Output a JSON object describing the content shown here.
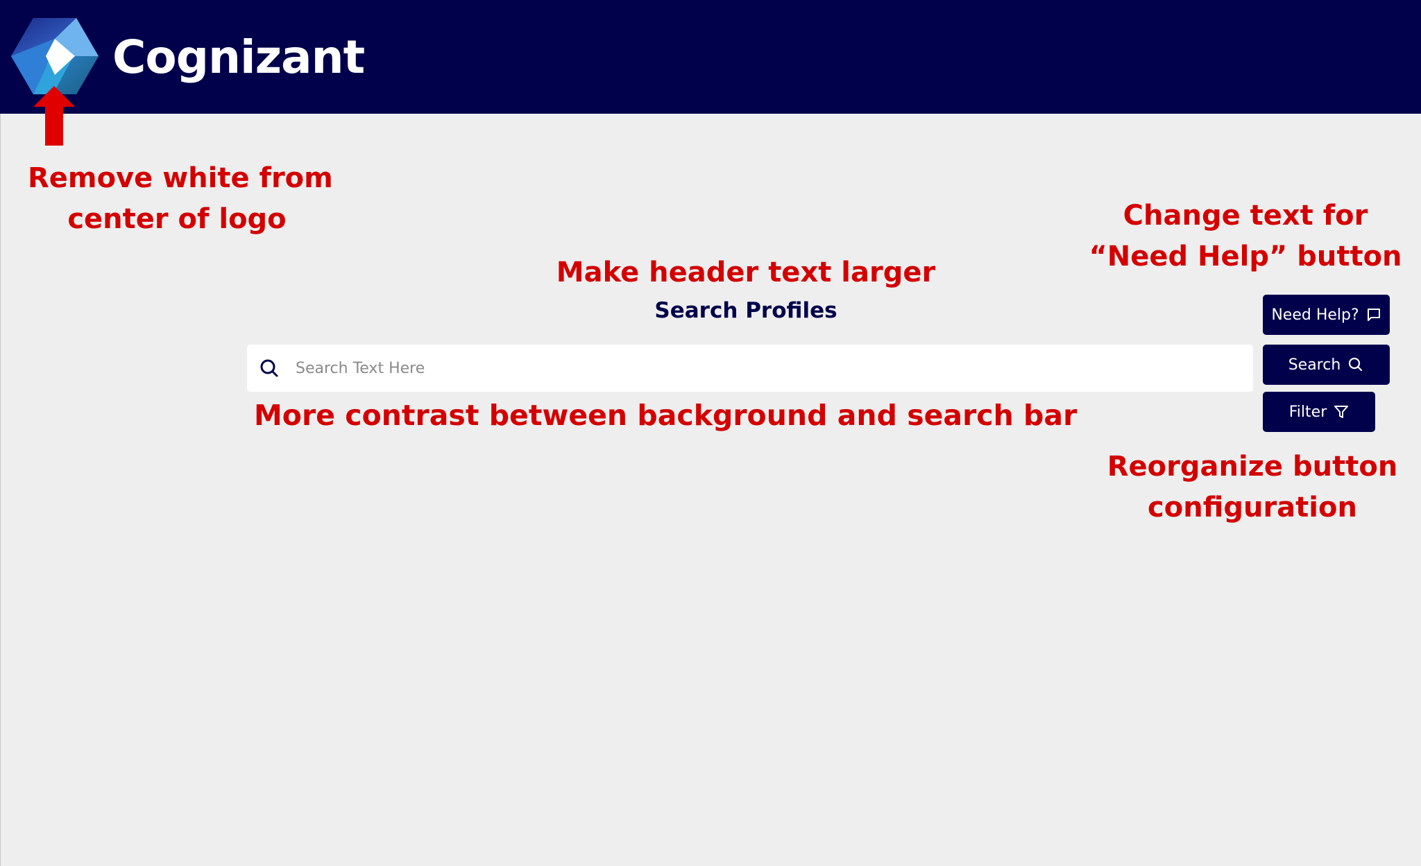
{
  "header": {
    "brand": "Cognizant",
    "background": "#00004b",
    "logo_icon": "cognizant-logo-icon"
  },
  "page": {
    "title": "Search Profiles",
    "background": "#eeeeee"
  },
  "search": {
    "placeholder": "Search Text Here",
    "value": "",
    "icon": "search-icon"
  },
  "buttons": {
    "help": {
      "label": "Need Help?",
      "icon": "chat-icon"
    },
    "search": {
      "label": "Search",
      "icon": "search-icon"
    },
    "filter": {
      "label": "Filter",
      "icon": "filter-icon"
    }
  },
  "annotations": {
    "color": "#d40000",
    "logo_line1": "Remove white from",
    "logo_line2": "center of logo",
    "header_text": "Make header text larger",
    "help_line1": "Change text for",
    "help_line2": "“Need Help” button",
    "contrast": "More contrast between background and search bar",
    "reorg_line1": "Reorganize button",
    "reorg_line2": "configuration"
  }
}
